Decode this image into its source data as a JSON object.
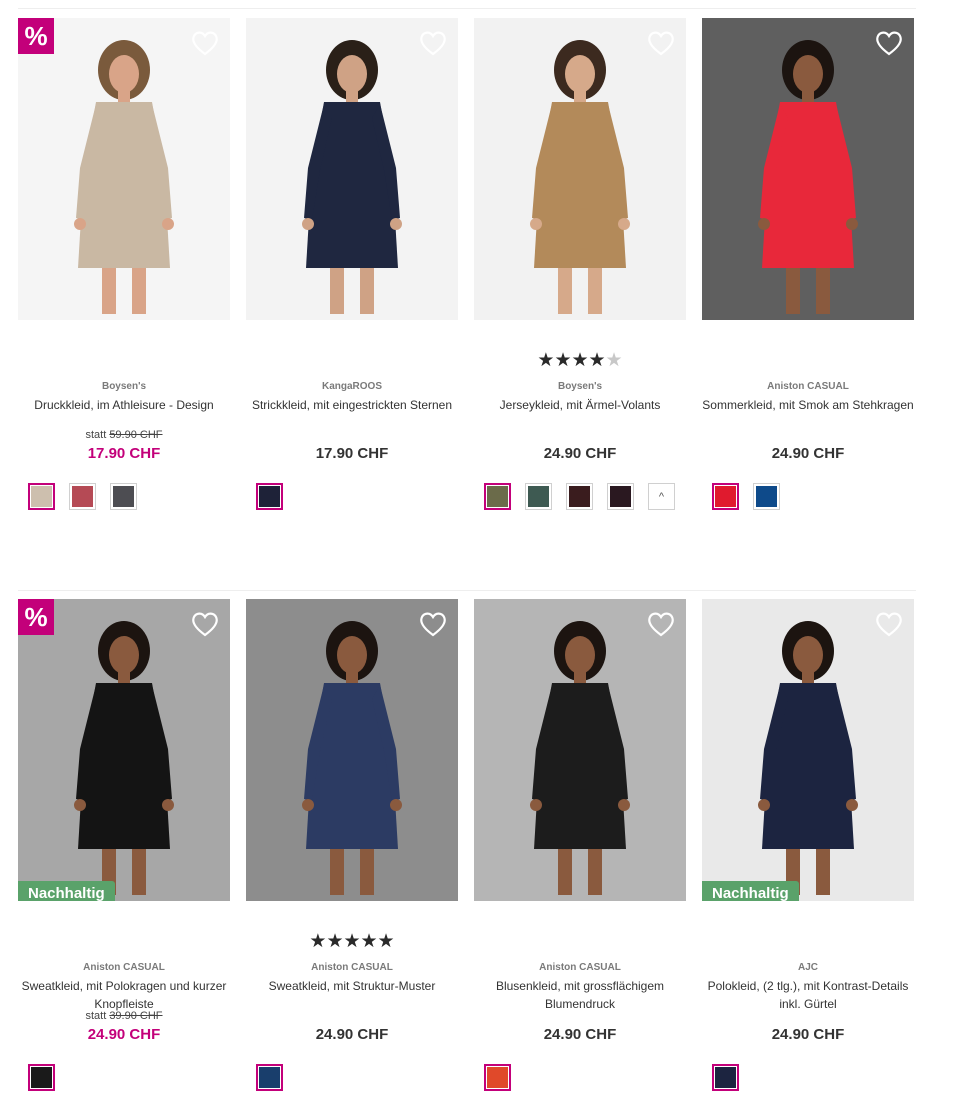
{
  "products": [
    {
      "brand": "Boysen's",
      "name": "Druckkleid, im Athleisure - Design",
      "old_price_prefix": "statt",
      "old_price": "59.90 CHF",
      "price": "17.90 CHF",
      "sale": true,
      "badge_sale": "%",
      "rating": null,
      "photo": {
        "bg": "#f5f5f5",
        "dress": "#c9b8a3",
        "skin": "#d9a488",
        "hair": "#7a5a3c"
      },
      "swatches": [
        "#cdbfae",
        "#b54a55",
        "#4d4d52"
      ]
    },
    {
      "brand": "KangaROOS",
      "name": "Strickkleid, mit eingestrickten Sternen",
      "price": "17.90 CHF",
      "sale": false,
      "rating": null,
      "photo": {
        "bg": "#f3f3f3",
        "dress": "#1f2740",
        "skin": "#cfa285",
        "hair": "#2a2018"
      },
      "swatches": [
        "#1e2238"
      ]
    },
    {
      "brand": "Boysen's",
      "name": "Jerseykleid, mit Ärmel-Volants",
      "price": "24.90 CHF",
      "sale": false,
      "rating": "★★★★",
      "rating_half": "★",
      "photo": {
        "bg": "#f2f2f2",
        "dress": "#b38a5a",
        "skin": "#d6a98a",
        "hair": "#3c2a1f"
      },
      "swatches": [
        "#6b6b4a",
        "#3e5a52",
        "#3a1c1e",
        "#2a1820"
      ],
      "more_label": "^"
    },
    {
      "brand": "Aniston CASUAL",
      "name": "Sommerkleid, mit Smok am Stehkragen",
      "price": "24.90 CHF",
      "sale": false,
      "rating": null,
      "photo": {
        "bg": "#5f5f5f",
        "dress": "#e8283a",
        "skin": "#8a5a3e",
        "hair": "#1c1410"
      },
      "swatches": [
        "#e01a2e",
        "#0e4a8a"
      ]
    },
    {
      "brand": "Aniston CASUAL",
      "name": "Sweatkleid, mit Polokragen und kurzer Knopfleiste",
      "old_price_prefix": "statt",
      "old_price": "39.90 CHF",
      "price": "24.90 CHF",
      "sale": true,
      "badge_sale": "%",
      "badge_eco": "Nachhaltig",
      "rating": null,
      "photo": {
        "bg": "#a7a7a7",
        "dress": "#141414",
        "skin": "#8a5a3e",
        "hair": "#1c1410"
      },
      "swatches": [
        "#1a1a1a"
      ]
    },
    {
      "brand": "Aniston CASUAL",
      "name": "Sweatkleid, mit Struktur-Muster",
      "price": "24.90 CHF",
      "sale": false,
      "rating": "★★★★★",
      "photo": {
        "bg": "#8d8d8d",
        "dress": "#2c3b63",
        "skin": "#8a5a3e",
        "hair": "#1c1410"
      },
      "swatches": [
        "#193e6c"
      ]
    },
    {
      "brand": "Aniston CASUAL",
      "name": "Blusenkleid, mit grossflächigem Blumendruck",
      "price": "24.90 CHF",
      "sale": false,
      "rating": null,
      "photo": {
        "bg": "#b5b5b5",
        "dress": "#1c1c1c",
        "skin": "#8a5a3e",
        "hair": "#1c1410"
      },
      "swatches": [
        "#e0492a"
      ]
    },
    {
      "brand": "AJC",
      "name": "Polokleid, (2 tlg.), mit Kontrast-Details inkl. Gürtel",
      "price": "24.90 CHF",
      "sale": false,
      "badge_eco": "Nachhaltig",
      "rating": null,
      "photo": {
        "bg": "#e9e9e9",
        "dress": "#1c2440",
        "skin": "#8a5a3e",
        "hair": "#1c1410"
      },
      "swatches": [
        "#1c2440"
      ]
    }
  ]
}
